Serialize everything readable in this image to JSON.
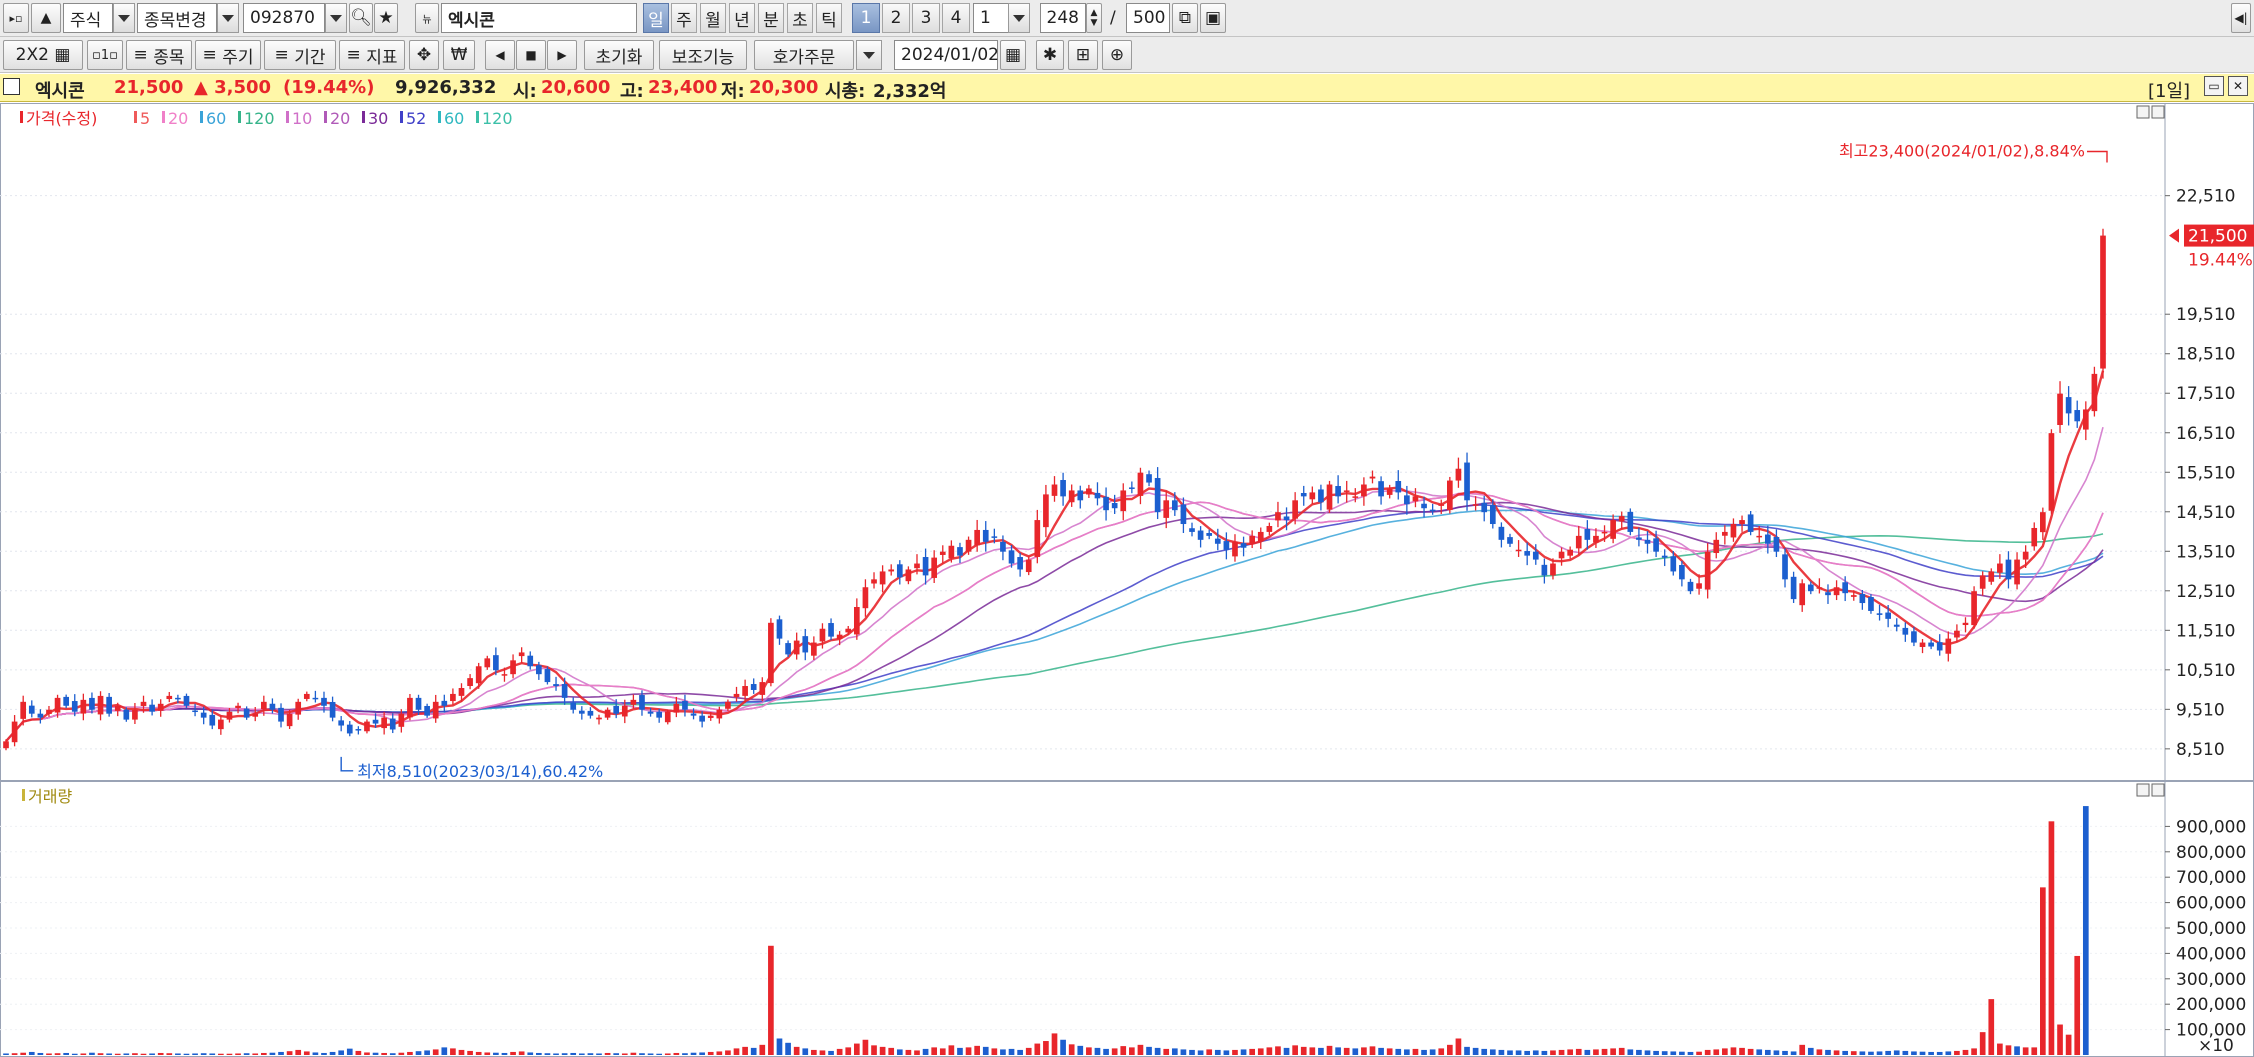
{
  "toolbar1": {
    "market": "주식",
    "change_label": "종목변경",
    "code": "092870",
    "name": "엑시콘",
    "periods": [
      "일",
      "주",
      "월",
      "년",
      "분",
      "초",
      "틱"
    ],
    "active_period": "일",
    "numbers": [
      "1",
      "2",
      "3",
      "4"
    ],
    "active_number": "1",
    "interval": "1",
    "bar_count": "248",
    "bar_max": "500"
  },
  "toolbar2": {
    "layout": "2X2",
    "stock_btn": "종목",
    "cycle_btn": "주기",
    "range_btn": "기간",
    "indicator_btn": "지표",
    "currency_icon": "₩",
    "reset_btn": "초기화",
    "aux_btn": "보조기능",
    "order_btn": "호가주문",
    "date": "2024/01/02"
  },
  "status": {
    "name": "엑시콘",
    "price": "21,500",
    "change": "▲ 3,500",
    "change_pct": "(19.44%)",
    "volume": "9,926,332",
    "open_label": "시:",
    "open": "20,600",
    "high_label": "고:",
    "high": "23,400",
    "low_label": "저:",
    "low": "20,300",
    "cap_label": "시총:",
    "cap": "2,332억",
    "period": "[1일]"
  },
  "colors": {
    "up": "#e8262b",
    "down": "#1c5fcf",
    "status_bg": "#fff7a8"
  },
  "chart_data": [
    {
      "type": "candlestick",
      "legend": [
        "가격(수정)",
        "5",
        "20",
        "60",
        "120",
        "10",
        "20",
        "30",
        "52",
        "60",
        "120"
      ],
      "legend_colors": [
        "#e8262b",
        "#ef5a5a",
        "#f080c8",
        "#3aa3d8",
        "#36b48a",
        "#d070c8",
        "#b05ab8",
        "#7a2a98",
        "#4040c8",
        "#2fb8c0",
        "#3cc0a8"
      ],
      "y_ticks": [
        8510,
        9510,
        10510,
        11510,
        12510,
        13510,
        14510,
        15510,
        16510,
        17510,
        18510,
        19510,
        22510
      ],
      "ylim": [
        8000,
        24400
      ],
      "current_price": "21,500",
      "current_pct": "19.44%",
      "high_annotation": "최고23,400(2024/01/02),8.84%",
      "low_annotation": "최저8,510(2023/03/14),60.42%",
      "closes": [
        8700,
        9200,
        9700,
        9400,
        9300,
        9500,
        9800,
        9600,
        9450,
        9750,
        9500,
        9850,
        9400,
        9600,
        9250,
        9500,
        9700,
        9450,
        9650,
        9850,
        9800,
        9600,
        9450,
        9300,
        9100,
        9250,
        9450,
        9600,
        9300,
        9400,
        9700,
        9500,
        9200,
        9400,
        9700,
        9900,
        9800,
        9600,
        9300,
        9100,
        8900,
        9000,
        9200,
        9150,
        9300,
        9000,
        9400,
        9800,
        9500,
        9350,
        9700,
        9600,
        9900,
        10050,
        10300,
        10600,
        10800,
        10500,
        10400,
        10750,
        10950,
        10600,
        10400,
        10200,
        10100,
        9800,
        9500,
        9400,
        9350,
        9300,
        9500,
        9400,
        9600,
        9750,
        9500,
        9400,
        9300,
        9450,
        9650,
        9500,
        9350,
        9200,
        9350,
        9500,
        9700,
        9900,
        10100,
        10000,
        10200,
        11700,
        11300,
        10900,
        11250,
        10950,
        11200,
        11550,
        11350,
        11400,
        11550,
        12100,
        12600,
        12800,
        13000,
        13050,
        12850,
        13050,
        13200,
        12900,
        13350,
        13500,
        13650,
        13400,
        13800,
        14050,
        13750,
        13850,
        13500,
        13200,
        13050,
        13300,
        14300,
        14950,
        15200,
        14900,
        15050,
        14800,
        15100,
        14850,
        14550,
        14600,
        15050,
        15100,
        15500,
        15250,
        14500,
        14800,
        14550,
        14200,
        14000,
        13800,
        13900,
        13700,
        13550,
        13750,
        13600,
        13900,
        14000,
        14150,
        14500,
        14300,
        14800,
        14900,
        15000,
        14750,
        15200,
        14900,
        15050,
        14900,
        15200,
        15400,
        14900,
        15100,
        15000,
        14700,
        14900,
        14600,
        14550,
        14700,
        15300,
        15600,
        14800,
        14700,
        14500,
        14200,
        13800,
        13700,
        13550,
        13400,
        13300,
        12900,
        13200,
        13500,
        13550,
        13900,
        13800,
        13900,
        14000,
        14300,
        14400,
        14000,
        13800,
        13700,
        13500,
        13350,
        13000,
        12800,
        12500,
        12700,
        13500,
        13800,
        14000,
        14200,
        14300,
        14000,
        13900,
        13700,
        13500,
        12800,
        12300,
        12700,
        12500,
        12600,
        12400,
        12600,
        12450,
        12400,
        12200,
        12000,
        11900,
        11800,
        11600,
        11400,
        11200,
        11200,
        11100,
        11000,
        11300,
        11500,
        11700,
        12500,
        12900,
        13000,
        13200,
        12800,
        13300,
        13500,
        14100,
        14500,
        16500,
        17500,
        17000,
        16800,
        17100,
        18000,
        21500
      ]
    },
    {
      "type": "bar",
      "legend": [
        "거래량"
      ],
      "y_ticks": [
        100000,
        200000,
        300000,
        400000,
        500000,
        600000,
        700000,
        800000,
        900000
      ],
      "ylim": [
        0,
        1000000
      ],
      "unit": "×10",
      "volumes": [
        6000,
        7000,
        9000,
        12000,
        8000,
        6000,
        7000,
        8000,
        5000,
        6000,
        9000,
        7000,
        6000,
        5000,
        6000,
        7000,
        5000,
        6000,
        8000,
        7000,
        6000,
        5000,
        6000,
        7000,
        6000,
        5000,
        5000,
        6000,
        7000,
        6000,
        8000,
        9000,
        12000,
        15000,
        20000,
        14000,
        10000,
        8000,
        12000,
        18000,
        25000,
        16000,
        10000,
        9000,
        8000,
        7000,
        9000,
        12000,
        15000,
        18000,
        22000,
        30000,
        26000,
        20000,
        16000,
        12000,
        10000,
        9000,
        8000,
        12000,
        14000,
        10000,
        8000,
        7000,
        6000,
        7000,
        8000,
        6000,
        7000,
        6000,
        8000,
        7000,
        6000,
        9000,
        7000,
        6000,
        5000,
        6000,
        8000,
        7000,
        9000,
        10000,
        12000,
        14000,
        18000,
        26000,
        32000,
        28000,
        40000,
        430000,
        65000,
        48000,
        32000,
        26000,
        20000,
        18000,
        16000,
        24000,
        30000,
        45000,
        60000,
        38000,
        32000,
        28000,
        22000,
        20000,
        18000,
        24000,
        30000,
        26000,
        38000,
        28000,
        30000,
        36000,
        32000,
        26000,
        22000,
        24000,
        20000,
        28000,
        45000,
        55000,
        85000,
        60000,
        42000,
        36000,
        30000,
        28000,
        24000,
        26000,
        35000,
        30000,
        40000,
        32000,
        28000,
        24000,
        26000,
        22000,
        20000,
        18000,
        22000,
        20000,
        18000,
        20000,
        22000,
        24000,
        26000,
        30000,
        34000,
        28000,
        38000,
        32000,
        30000,
        28000,
        36000,
        30000,
        28000,
        26000,
        30000,
        34000,
        28000,
        26000,
        24000,
        22000,
        24000,
        20000,
        22000,
        26000,
        40000,
        65000,
        32000,
        28000,
        24000,
        22000,
        20000,
        18000,
        18000,
        16000,
        18000,
        16000,
        18000,
        20000,
        22000,
        24000,
        20000,
        22000,
        24000,
        26000,
        28000,
        22000,
        20000,
        18000,
        16000,
        15000,
        14000,
        13000,
        12000,
        13000,
        20000,
        22000,
        26000,
        30000,
        28000,
        24000,
        22000,
        20000,
        18000,
        16000,
        14000,
        40000,
        28000,
        22000,
        20000,
        18000,
        16000,
        15000,
        14000,
        13000,
        14000,
        16000,
        18000,
        16000,
        14000,
        13000,
        12000,
        12000,
        14000,
        16000,
        20000,
        26000,
        90000,
        220000,
        45000,
        38000,
        34000,
        30000,
        30000,
        660000,
        920000,
        120000,
        80000,
        390000,
        980000
      ],
      "vol_dirs": [
        0,
        1,
        1,
        0,
        0,
        1,
        1,
        0,
        0,
        1,
        0,
        1,
        0,
        1,
        0,
        1,
        1,
        0,
        1,
        1,
        0,
        0,
        0,
        0,
        0,
        1,
        1,
        1,
        0,
        1,
        1,
        0,
        0,
        1,
        1,
        1,
        0,
        0,
        0,
        0,
        0,
        1,
        1,
        0,
        1,
        0,
        1,
        1,
        0,
        0,
        1,
        0,
        1,
        1,
        1,
        1,
        1,
        0,
        0,
        1,
        1,
        0,
        0,
        0,
        0,
        0,
        0,
        0,
        0,
        0,
        1,
        0,
        1,
        1,
        0,
        0,
        0,
        1,
        1,
        0,
        0,
        0,
        1,
        1,
        1,
        1,
        1,
        0,
        1,
        1,
        0,
        0,
        1,
        0,
        1,
        1,
        0,
        1,
        1,
        1,
        1,
        1,
        1,
        1,
        0,
        1,
        1,
        0,
        1,
        1,
        1,
        0,
        1,
        1,
        0,
        1,
        0,
        0,
        0,
        1,
        1,
        1,
        1,
        0,
        1,
        0,
        1,
        0,
        0,
        1,
        1,
        1,
        1,
        0,
        0,
        1,
        0,
        0,
        0,
        0,
        1,
        0,
        0,
        1,
        0,
        1,
        1,
        1,
        1,
        0,
        1,
        1,
        1,
        0,
        1,
        0,
        1,
        0,
        1,
        1,
        0,
        1,
        0,
        0,
        1,
        0,
        0,
        1,
        1,
        1,
        0,
        0,
        0,
        0,
        0,
        0,
        0,
        0,
        0,
        0,
        1,
        1,
        1,
        1,
        0,
        1,
        1,
        1,
        1,
        0,
        0,
        0,
        0,
        0,
        0,
        0,
        0,
        1,
        1,
        1,
        1,
        1,
        1,
        1,
        0,
        0,
        0,
        0,
        0,
        1,
        0,
        1,
        0,
        1,
        0,
        1,
        0,
        0,
        0,
        0,
        0,
        0,
        0,
        0,
        0,
        0,
        0,
        1,
        1,
        1,
        1,
        1,
        1,
        1,
        0,
        1,
        1,
        1,
        1,
        1,
        1,
        1,
        0,
        0,
        1,
        1,
        1
      ]
    }
  ]
}
